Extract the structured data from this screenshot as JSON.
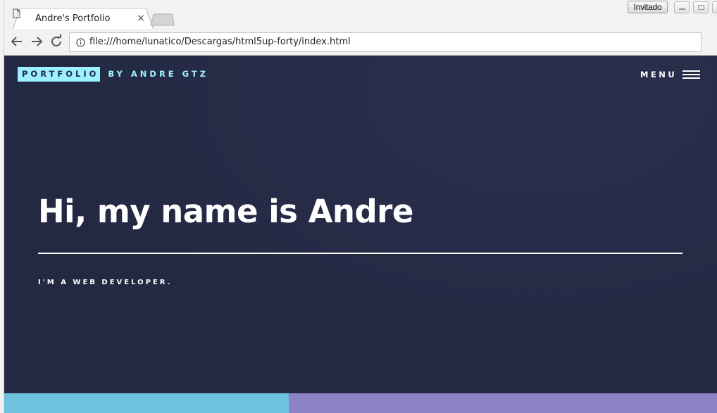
{
  "browser": {
    "tab": {
      "title": "Andre's Portfolio",
      "close_glyph": "×",
      "favicon": "page-icon"
    },
    "guest_label": "Invitado",
    "window_controls": [
      "minimize-icon",
      "maximize-icon",
      "close-icon"
    ],
    "toolbar": {
      "back_icon": "arrow-left-icon",
      "forward_icon": "arrow-right-icon",
      "reload_icon": "reload-icon",
      "info_icon": "info-icon",
      "url": "file:///home/lunatico/Descargas/html5up-forty/index.html"
    }
  },
  "page": {
    "header": {
      "brand_strong": "PORTFOLIO",
      "brand_rest": "BY ANDRE GTZ",
      "menu_label": "MENU",
      "menu_icon": "hamburger-icon"
    },
    "banner": {
      "title": "Hi, my name is Andre",
      "subtitle": "I'M A WEB DEVELOPER."
    },
    "colors": {
      "background": "#242943",
      "accent": "#9bf1ff",
      "tile_1": "#6fc3df",
      "tile_2": "#8d82c4"
    }
  }
}
